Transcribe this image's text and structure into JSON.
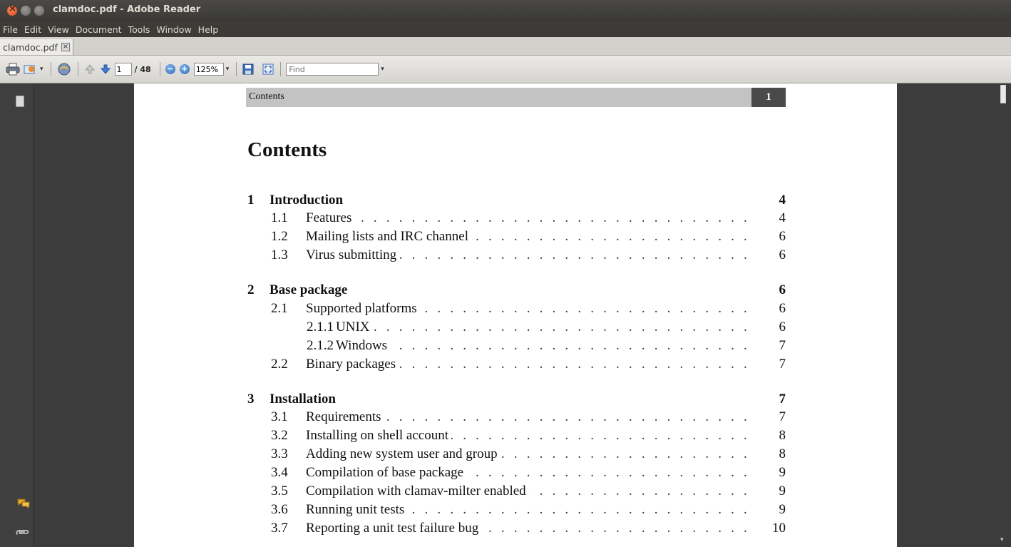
{
  "window": {
    "title": "clamdoc.pdf - Adobe Reader"
  },
  "menu": [
    "File",
    "Edit",
    "View",
    "Document",
    "Tools",
    "Window",
    "Help"
  ],
  "tab": {
    "label": "clamdoc.pdf",
    "close_glyph": "×"
  },
  "toolbar": {
    "page_current": "1",
    "page_total": "/ 48",
    "zoom": "125%",
    "find_placeholder": "Find",
    "icons": [
      "print-icon",
      "email-icon",
      "collaborate-icon",
      "previous-page-icon",
      "next-page-icon",
      "zoom-out-icon",
      "zoom-in-icon",
      "save-icon",
      "fit-page-icon"
    ]
  },
  "sidebar": {
    "icons": [
      "pages-icon",
      "comments-icon",
      "attachments-icon"
    ]
  },
  "document": {
    "header_label": "Contents",
    "header_page": "1",
    "heading": "Contents",
    "toc": [
      {
        "num": "1",
        "title": "Introduction",
        "page": "4",
        "level": 0
      },
      {
        "num": "1.1",
        "title": "Features",
        "page": "4",
        "level": 1
      },
      {
        "num": "1.2",
        "title": "Mailing lists and IRC channel",
        "page": "6",
        "level": 1
      },
      {
        "num": "1.3",
        "title": "Virus submitting",
        "page": "6",
        "level": 1
      },
      {
        "num": "2",
        "title": "Base package",
        "page": "6",
        "level": 0
      },
      {
        "num": "2.1",
        "title": "Supported platforms",
        "page": "6",
        "level": 1
      },
      {
        "num": "2.1.1",
        "title": "UNIX",
        "page": "6",
        "level": 2
      },
      {
        "num": "2.1.2",
        "title": "Windows",
        "page": "7",
        "level": 2
      },
      {
        "num": "2.2",
        "title": "Binary packages",
        "page": "7",
        "level": 1
      },
      {
        "num": "3",
        "title": "Installation",
        "page": "7",
        "level": 0
      },
      {
        "num": "3.1",
        "title": "Requirements",
        "page": "7",
        "level": 1
      },
      {
        "num": "3.2",
        "title": "Installing on shell account",
        "page": "8",
        "level": 1
      },
      {
        "num": "3.3",
        "title": "Adding new system user and group",
        "page": "8",
        "level": 1
      },
      {
        "num": "3.4",
        "title": "Compilation of base package",
        "page": "9",
        "level": 1
      },
      {
        "num": "3.5",
        "title": "Compilation with clamav-milter enabled",
        "page": "9",
        "level": 1
      },
      {
        "num": "3.6",
        "title": "Running unit tests",
        "page": "9",
        "level": 1
      },
      {
        "num": "3.7",
        "title": "Reporting a unit test failure bug",
        "page": "10",
        "level": 1
      }
    ]
  }
}
